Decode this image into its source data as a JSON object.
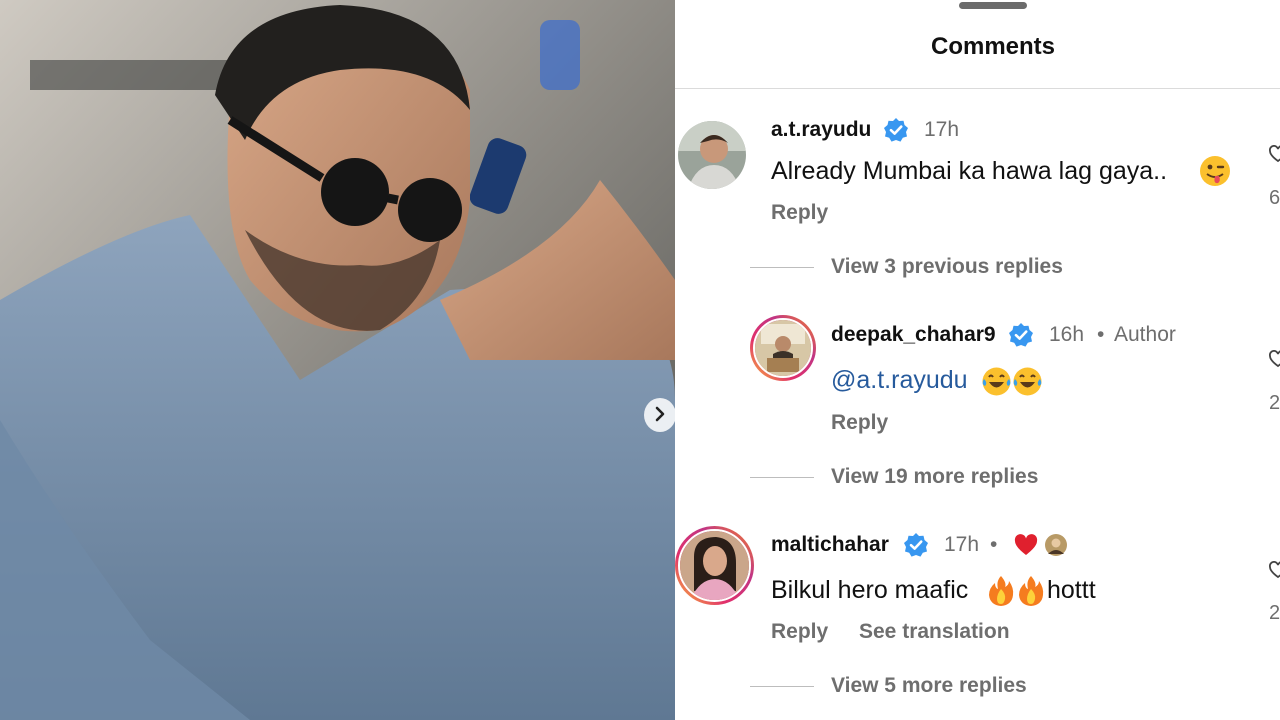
{
  "panel": {
    "title": "Comments"
  },
  "comments": [
    {
      "username": "a.t.rayudu",
      "time": "17h",
      "text": "Already Mumbai ka hawa lag gaya..",
      "reply_label": "Reply",
      "like_count": "6",
      "replies_link": "View 3 previous replies"
    },
    {
      "username": "deepak_chahar9",
      "time": "16h",
      "author_sep": "•",
      "author_label": "Author",
      "mention": "@a.t.rayudu",
      "reply_label": "Reply",
      "like_count": "2",
      "replies_link": "View 19 more replies"
    },
    {
      "username": "maltichahar",
      "time": "17h",
      "time_sep": "•",
      "text": "Bilkul hero maafic",
      "text_tail": "hottt",
      "reply_label": "Reply",
      "translate_label": "See translation",
      "like_count": "2",
      "replies_link": "View 5 more replies"
    }
  ],
  "icons": {
    "verified": "verified-badge-icon",
    "heart": "heart-icon",
    "next": "chevron-right-icon"
  },
  "colors": {
    "verified": "#3897f0",
    "mention": "#265a9c",
    "heart": "#e0202e"
  }
}
